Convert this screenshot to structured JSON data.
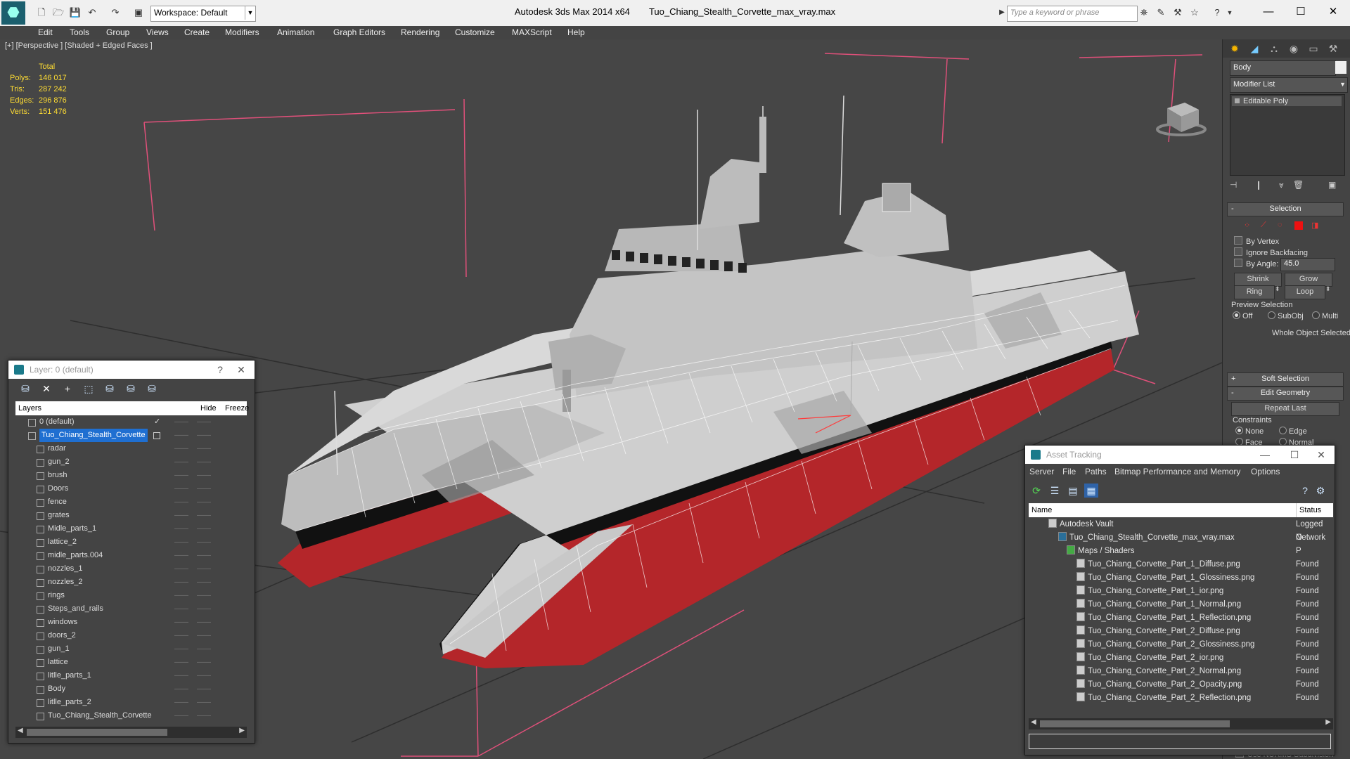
{
  "titlebar": {
    "app_title": "Autodesk 3ds Max  2014 x64",
    "file_title": "Tuo_Chiang_Stealth_Corvette_max_vray.max",
    "workspace_label": "Workspace: Default",
    "search_placeholder": "Type a keyword or phrase"
  },
  "menu": [
    "Edit",
    "Tools",
    "Group",
    "Views",
    "Create",
    "Modifiers",
    "Animation",
    "Graph Editors",
    "Rendering",
    "Customize",
    "MAXScript",
    "Help"
  ],
  "viewport": {
    "label": "[+] [Perspective ] [Shaded + Edged Faces ]",
    "stats": {
      "header": "Total",
      "rows": [
        {
          "label": "Polys:",
          "value": "146 017"
        },
        {
          "label": "Tris:",
          "value": "287 242"
        },
        {
          "label": "Edges:",
          "value": "296 876"
        },
        {
          "label": "Verts:",
          "value": "151 476"
        }
      ]
    }
  },
  "command_panel": {
    "object_name": "Body",
    "modifier_list": "Modifier List",
    "stack": [
      "Editable Poly"
    ],
    "selection": {
      "title": "Selection",
      "by_vertex": "By Vertex",
      "ignore_backfacing": "Ignore Backfacing",
      "by_angle": "By Angle:",
      "angle_value": "45.0",
      "shrink": "Shrink",
      "grow": "Grow",
      "ring": "Ring",
      "loop": "Loop",
      "preview_selection": "Preview Selection",
      "preview_options": [
        "Off",
        "SubObj",
        "Multi"
      ],
      "status": "Whole Object Selected"
    },
    "soft_selection": "Soft Selection",
    "edit_geometry": "Edit Geometry",
    "repeat_last": "Repeat Last",
    "constraints": "Constraints",
    "constraint_options": [
      "None",
      "Edge",
      "Face",
      "Normal"
    ],
    "footer": "Use NURMS Subdivision"
  },
  "layer_window": {
    "title": "Layer: 0 (default)",
    "help": "?",
    "columns": {
      "layers": "Layers",
      "hide": "Hide",
      "freeze": "Freeze"
    },
    "rows": [
      {
        "name": "0 (default)",
        "level": 0
      },
      {
        "name": "Tuo_Chiang_Stealth_Corvette",
        "level": 0
      },
      {
        "name": "radar",
        "level": 1
      },
      {
        "name": "gun_2",
        "level": 1
      },
      {
        "name": "brush",
        "level": 1
      },
      {
        "name": "Doors",
        "level": 1
      },
      {
        "name": "fence",
        "level": 1
      },
      {
        "name": "grates",
        "level": 1
      },
      {
        "name": "Midle_parts_1",
        "level": 1
      },
      {
        "name": "lattice_2",
        "level": 1
      },
      {
        "name": "midle_parts.004",
        "level": 1
      },
      {
        "name": "nozzles_1",
        "level": 1
      },
      {
        "name": "nozzles_2",
        "level": 1
      },
      {
        "name": "rings",
        "level": 1
      },
      {
        "name": "Steps_and_rails",
        "level": 1
      },
      {
        "name": "windows",
        "level": 1
      },
      {
        "name": "doors_2",
        "level": 1
      },
      {
        "name": "gun_1",
        "level": 1
      },
      {
        "name": "lattice",
        "level": 1
      },
      {
        "name": "litlle_parts_1",
        "level": 1
      },
      {
        "name": "Body",
        "level": 1
      },
      {
        "name": "litlle_parts_2",
        "level": 1
      },
      {
        "name": "Tuo_Chiang_Stealth_Corvette",
        "level": 1
      }
    ]
  },
  "asset_window": {
    "title": "Asset Tracking",
    "menu": [
      "Server",
      "File",
      "Paths",
      "Bitmap Performance and Memory",
      "Options"
    ],
    "columns": {
      "name": "Name",
      "status": "Status"
    },
    "rows": [
      {
        "name": "Autodesk Vault",
        "status": "Logged O",
        "level": 0
      },
      {
        "name": "Tuo_Chiang_Stealth_Corvette_max_vray.max",
        "status": "Network P",
        "level": 1
      },
      {
        "name": "Maps / Shaders",
        "status": "",
        "level": 2
      },
      {
        "name": "Tuo_Chiang_Corvette_Part_1_Diffuse.png",
        "status": "Found",
        "level": 3
      },
      {
        "name": "Tuo_Chiang_Corvette_Part_1_Glossiness.png",
        "status": "Found",
        "level": 3
      },
      {
        "name": "Tuo_Chiang_Corvette_Part_1_ior.png",
        "status": "Found",
        "level": 3
      },
      {
        "name": "Tuo_Chiang_Corvette_Part_1_Normal.png",
        "status": "Found",
        "level": 3
      },
      {
        "name": "Tuo_Chiang_Corvette_Part_1_Reflection.png",
        "status": "Found",
        "level": 3
      },
      {
        "name": "Tuo_Chiang_Corvette_Part_2_Diffuse.png",
        "status": "Found",
        "level": 3
      },
      {
        "name": "Tuo_Chiang_Corvette_Part_2_Glossiness.png",
        "status": "Found",
        "level": 3
      },
      {
        "name": "Tuo_Chiang_Corvette_Part_2_ior.png",
        "status": "Found",
        "level": 3
      },
      {
        "name": "Tuo_Chiang_Corvette_Part_2_Normal.png",
        "status": "Found",
        "level": 3
      },
      {
        "name": "Tuo_Chiang_Corvette_Part_2_Opacity.png",
        "status": "Found",
        "level": 3
      },
      {
        "name": "Tuo_Chiang_Corvette_Part_2_Reflection.png",
        "status": "Found",
        "level": 3
      }
    ]
  },
  "colors": {
    "viewport_bg": "#464646",
    "stats_text": "#ffdd33",
    "selection_blue": "#1f6fd1",
    "hull_red": "#b4262a",
    "bounding_box": "#e0507a"
  }
}
